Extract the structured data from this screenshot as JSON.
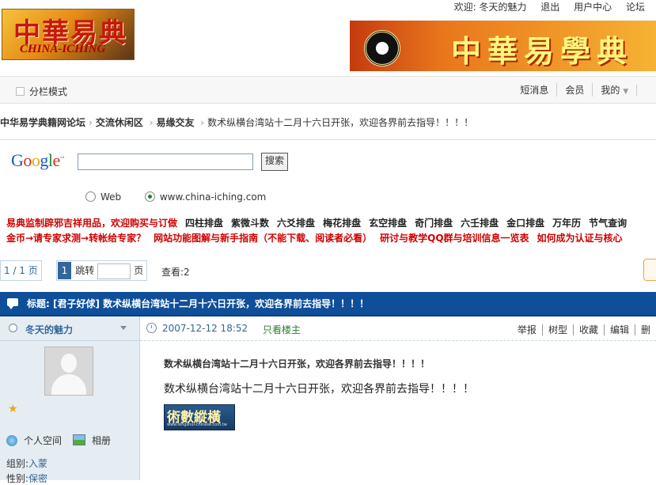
{
  "header": {
    "logo_text": "中華易典",
    "logo_sub": "CHINA-ICHING",
    "banner_text": "中華易學典籍",
    "welcome": "欢迎: 冬天的魅力",
    "logout": "退出",
    "user_center": "用户中心",
    "forum": "论坛"
  },
  "navbar": {
    "split_mode": "分栏模式",
    "sms": "短消息",
    "member": "会员",
    "mine": "我的"
  },
  "breadcrumb": {
    "home": "中华易学典籍网论坛",
    "section": "交流休闲区",
    "board": "易缘交友",
    "current": "数术纵横台湾站十二月十六日开张，欢迎各界前去指导！！！！"
  },
  "google": {
    "logo": "Google",
    "search_value": "",
    "search_button": "搜索",
    "option_web": "Web",
    "option_site": "www.china-iching.com"
  },
  "links": {
    "row1": [
      {
        "text": "易典监制辟邪吉祥用品，欢迎购买与订做",
        "red": true
      },
      {
        "text": "四柱排盘",
        "red": false
      },
      {
        "text": "紫微斗数",
        "red": false
      },
      {
        "text": "六爻排盘",
        "red": false
      },
      {
        "text": "梅花排盘",
        "red": false
      },
      {
        "text": "玄空排盘",
        "red": false
      },
      {
        "text": "奇门排盘",
        "red": false
      },
      {
        "text": "六壬排盘",
        "red": false
      },
      {
        "text": "金口排盘",
        "red": false
      },
      {
        "text": "万年历",
        "red": false
      },
      {
        "text": "节气查询",
        "red": false
      }
    ],
    "row2": [
      {
        "text": "金币→请专家求测→转帐给专家？",
        "red": true
      },
      {
        "text": "网站功能图解与新手指南（不能下载、阅读者必看）",
        "red": true
      },
      {
        "text": "研讨与教学QQ群与培训信息一览表",
        "red": true
      },
      {
        "text": "如何成为认证与核心",
        "red": true
      }
    ]
  },
  "pager": {
    "count": "1 / 1 页",
    "current_page": "1",
    "jump": "跳转",
    "page_suffix": "页",
    "views_label": "查看:",
    "views_value": "2"
  },
  "thread": {
    "title": "标题: [君子好俅] 数术纵横台湾站十二月十六日开张，欢迎各界前去指导！！！！"
  },
  "post": {
    "author": "冬天的魅力",
    "date": "2007-12-12 18:52",
    "only_host": "只看楼主",
    "actions": [
      "举报",
      "树型",
      "收藏",
      "编辑",
      "删"
    ],
    "title": "数术纵横台湾站十二月十六日开张，欢迎各界前去指导！！！！",
    "body": "数术纵横台湾站十二月十六日开张，欢迎各界前去指导！！！！",
    "image_text": "術數縱橫",
    "image_url_text": "www.fengshui-chinese.com.tw",
    "personal_space": "个人空间",
    "album": "相册",
    "group_label": "组别:",
    "group_value": "入蒙",
    "gender_label": "性别:",
    "gender_value": "保密"
  },
  "colors": {
    "title_bar": "#0f4f9a",
    "link_red": "#d00000",
    "link_blue": "#336699",
    "sidebar_bg": "#e5edf2"
  }
}
